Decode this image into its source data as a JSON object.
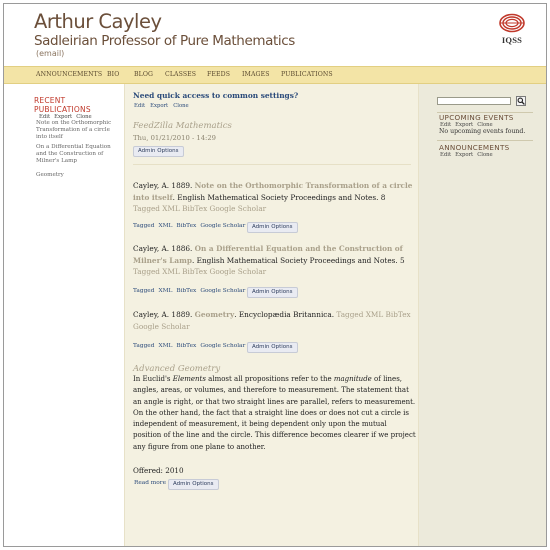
{
  "header": {
    "title": "Arthur Cayley",
    "subtitle": "Sadleirian Professor of Pure Mathematics",
    "email": "(email)",
    "logo_text": "IQSS"
  },
  "nav": {
    "items": [
      "ANNOUNCEMENTS",
      "BIO",
      "BLOG",
      "CLASSES",
      "FEEDS",
      "IMAGES",
      "PUBLICATIONS"
    ]
  },
  "left": {
    "recent_title_1": "RECENT",
    "recent_title_2": "PUBLICATIONS",
    "widget_links": [
      "Edit",
      "Export",
      "Clone"
    ],
    "links": [
      "Note on the Orthomorphic Transformation of a circle into itself",
      "On a Differential Equation and the Construction of Milner's Lamp",
      "Geometry"
    ]
  },
  "main": {
    "quick_title": "Need quick access to common settings?",
    "quick_links": [
      "Edit",
      "Export",
      "Clone"
    ],
    "feed_title": "FeedZilla Mathematics",
    "feed_date": "Thu, 01/21/2010 - 14:29",
    "admin_label": "Admin Options",
    "publications": [
      {
        "author": "Cayley, A.",
        "year": "1889.",
        "title": "Note on the Orthomorphic Transformation of a circle into itself",
        "venue": ". English Mathematical Society Proceedings and Notes. 8",
        "tail": "Tagged XML BibTex Google Scholar",
        "links": [
          "Tagged",
          "XML",
          "BibTex",
          "Google Scholar"
        ]
      },
      {
        "author": "Cayley, A.",
        "year": "1886.",
        "title": "On a Differential Equation and the Construction of Milner's Lamp",
        "venue": ". English Mathematical Society Proceedings and Notes. 5",
        "tail": "Tagged XML BibTex Google Scholar",
        "links": [
          "Tagged",
          "XML",
          "BibTex",
          "Google Scholar"
        ]
      },
      {
        "author": "Cayley, A.",
        "year": "1889.",
        "title": "Geometry",
        "venue": ". Encyclopædia Britannica.",
        "tail": "Tagged XML BibTex Google Scholar",
        "links": [
          "Tagged",
          "XML",
          "BibTex",
          "Google Scholar"
        ]
      }
    ],
    "class": {
      "title": "Advanced Geometry",
      "body_pre": "In Euclid's ",
      "body_em1": "Elements",
      "body_mid": " almost all propositions refer to the ",
      "body_em2": "magnitude",
      "body_post": " of lines, angles, areas, or volumes, and therefore to measurement. The statement that an angle is right, or that two straight lines are parallel, refers to measurement. On the other hand, the fact that a straight line does or does not cut a circle is independent of measurement, it being dependent only upon the mutual position of the line and the circle. This difference becomes clearer if we project any figure from one plane to another.",
      "offered": "Offered:  2010",
      "read_more": "Read more"
    }
  },
  "right": {
    "upcoming_title": "UPCOMING EVENTS",
    "upcoming_links": [
      "Edit",
      "Export",
      "Clone"
    ],
    "upcoming_text": "No upcoming events found.",
    "announcements_title": "ANNOUNCEMENTS",
    "announcements_links": [
      "Edit",
      "Export",
      "Clone"
    ]
  }
}
